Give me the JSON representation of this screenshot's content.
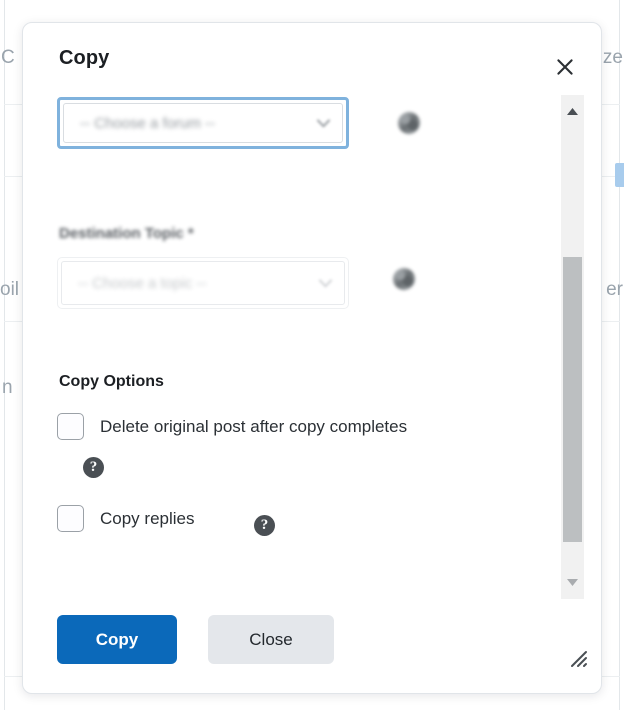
{
  "background": {
    "fragments": [
      {
        "id": "left-c",
        "text": "C"
      },
      {
        "id": "left-oil",
        "text": "oil"
      },
      {
        "id": "left-n",
        "text": "n"
      },
      {
        "id": "right-ze",
        "text": "ze"
      },
      {
        "id": "right-er",
        "text": "er"
      }
    ]
  },
  "modal": {
    "title": "Copy",
    "close_icon": "close-icon",
    "fields": {
      "forum": {
        "value": "-- Choose a forum --",
        "caret_icon": "chevron-down-icon",
        "side_icon": "spinner-icon",
        "focused": true
      },
      "topic": {
        "label": "Destination Topic *",
        "value": "-- Choose a topic --",
        "caret_icon": "chevron-down-icon",
        "side_icon": "spinner-icon",
        "disabled": true
      }
    },
    "options": {
      "title": "Copy Options",
      "items": [
        {
          "label": "Delete original post after copy completes",
          "checked": false,
          "help_icon": "help-circle-icon"
        },
        {
          "label": "Copy replies",
          "checked": false,
          "help_icon": "help-circle-icon"
        }
      ]
    },
    "scrollbar": {
      "up_icon": "triangle-up-icon",
      "down_icon": "triangle-down-icon",
      "thumb_label": "scrollbar-thumb"
    },
    "footer": {
      "primary_label": "Copy",
      "secondary_label": "Close",
      "resize_icon": "resize-grip-icon"
    }
  },
  "colors": {
    "primary": "#0b69ba",
    "secondary_bg": "#e4e7eb",
    "focus_border": "#7fb2dd",
    "scrollbar_thumb": "#bcbfc1",
    "help_icon_bg": "#4a4f54"
  }
}
